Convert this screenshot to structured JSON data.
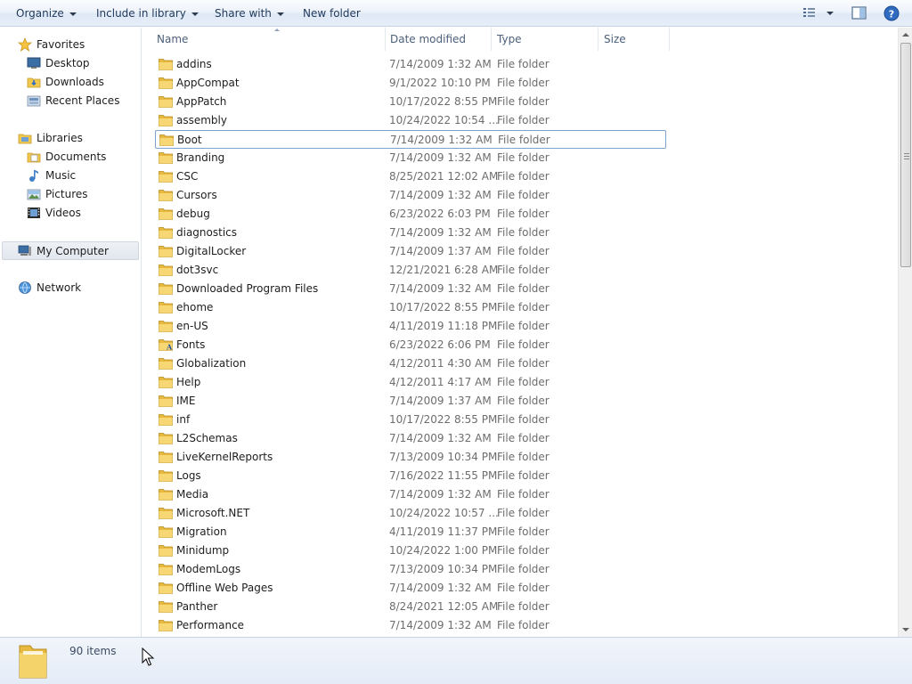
{
  "toolbar": {
    "organize": "Organize",
    "include_in_library": "Include in library",
    "share_with": "Share with",
    "new_folder": "New folder",
    "icons": [
      "view-options-icon",
      "preview-pane-icon",
      "help-icon"
    ]
  },
  "nav": {
    "favorites": "Favorites",
    "desktop": "Desktop",
    "downloads": "Downloads",
    "recent_places": "Recent Places",
    "libraries": "Libraries",
    "documents": "Documents",
    "music": "Music",
    "pictures": "Pictures",
    "videos": "Videos",
    "my_computer": "My Computer",
    "network": "Network"
  },
  "columns": {
    "name": "Name",
    "date_modified": "Date modified",
    "type": "Type",
    "size": "Size"
  },
  "files": [
    {
      "name": "addins",
      "date": "7/14/2009 1:32 AM",
      "type": "File folder"
    },
    {
      "name": "AppCompat",
      "date": "9/1/2022 10:10 PM",
      "type": "File folder"
    },
    {
      "name": "AppPatch",
      "date": "10/17/2022 8:55 PM",
      "type": "File folder"
    },
    {
      "name": "assembly",
      "date": "10/24/2022 10:54 ...",
      "type": "File folder"
    },
    {
      "name": "Boot",
      "date": "7/14/2009 1:32 AM",
      "type": "File folder"
    },
    {
      "name": "Branding",
      "date": "7/14/2009 1:32 AM",
      "type": "File folder"
    },
    {
      "name": "CSC",
      "date": "8/25/2021 12:02 AM",
      "type": "File folder"
    },
    {
      "name": "Cursors",
      "date": "7/14/2009 1:32 AM",
      "type": "File folder"
    },
    {
      "name": "debug",
      "date": "6/23/2022 6:03 PM",
      "type": "File folder"
    },
    {
      "name": "diagnostics",
      "date": "7/14/2009 1:32 AM",
      "type": "File folder"
    },
    {
      "name": "DigitalLocker",
      "date": "7/14/2009 1:37 AM",
      "type": "File folder"
    },
    {
      "name": "dot3svc",
      "date": "12/21/2021 6:28 AM",
      "type": "File folder"
    },
    {
      "name": "Downloaded Program Files",
      "date": "7/14/2009 1:32 AM",
      "type": "File folder"
    },
    {
      "name": "ehome",
      "date": "10/17/2022 8:55 PM",
      "type": "File folder"
    },
    {
      "name": "en-US",
      "date": "4/11/2019 11:18 PM",
      "type": "File folder"
    },
    {
      "name": "Fonts",
      "date": "6/23/2022 6:06 PM",
      "type": "File folder"
    },
    {
      "name": "Globalization",
      "date": "4/12/2011 4:30 AM",
      "type": "File folder"
    },
    {
      "name": "Help",
      "date": "4/12/2011 4:17 AM",
      "type": "File folder"
    },
    {
      "name": "IME",
      "date": "7/14/2009 1:37 AM",
      "type": "File folder"
    },
    {
      "name": "inf",
      "date": "10/17/2022 8:55 PM",
      "type": "File folder"
    },
    {
      "name": "L2Schemas",
      "date": "7/14/2009 1:32 AM",
      "type": "File folder"
    },
    {
      "name": "LiveKernelReports",
      "date": "7/13/2009 10:34 PM",
      "type": "File folder"
    },
    {
      "name": "Logs",
      "date": "7/16/2022 11:55 PM",
      "type": "File folder"
    },
    {
      "name": "Media",
      "date": "7/14/2009 1:32 AM",
      "type": "File folder"
    },
    {
      "name": "Microsoft.NET",
      "date": "10/24/2022 10:57 ...",
      "type": "File folder"
    },
    {
      "name": "Migration",
      "date": "4/11/2019 11:37 PM",
      "type": "File folder"
    },
    {
      "name": "Minidump",
      "date": "10/24/2022 1:00 PM",
      "type": "File folder"
    },
    {
      "name": "ModemLogs",
      "date": "7/13/2009 10:34 PM",
      "type": "File folder"
    },
    {
      "name": "Offline Web Pages",
      "date": "7/14/2009 1:32 AM",
      "type": "File folder"
    },
    {
      "name": "Panther",
      "date": "8/24/2021 12:05 AM",
      "type": "File folder"
    },
    {
      "name": "Performance",
      "date": "7/14/2009 1:32 AM",
      "type": "File folder"
    }
  ],
  "status": {
    "item_count": "90 items"
  },
  "colors": {
    "folder": "#f2c94c",
    "accent": "#1e395b"
  }
}
